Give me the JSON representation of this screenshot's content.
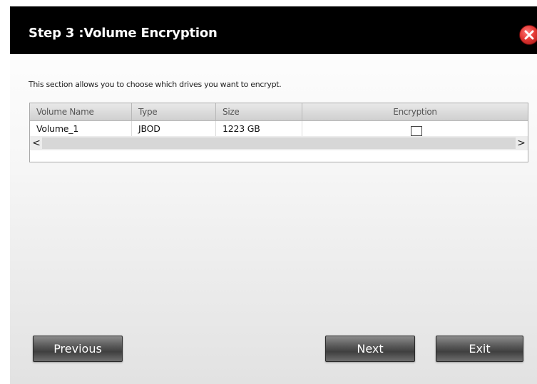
{
  "dialog": {
    "title": "Step 3 :Volume Encryption",
    "close_icon": "close-x-icon",
    "description": "This section allows you to choose which drives you want to encrypt."
  },
  "table": {
    "columns": [
      "Volume Name",
      "Type",
      "Size",
      "Encryption"
    ],
    "rows": [
      {
        "volume_name": "Volume_1",
        "type": "JBOD",
        "size": "1223 GB",
        "encryption": false
      }
    ],
    "scroll_left": "<",
    "scroll_right": ">"
  },
  "buttons": {
    "previous": "Previous",
    "next": "Next",
    "exit": "Exit"
  },
  "colors": {
    "titlebar": "#000000",
    "close_button": "#e53935",
    "button": "#4a4a4a"
  }
}
